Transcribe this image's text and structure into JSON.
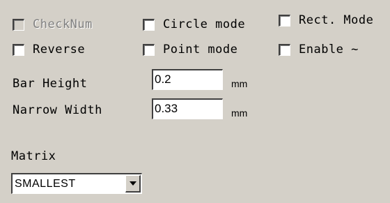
{
  "options": {
    "checknum": "CheckNum",
    "circle_mode": "Circle mode",
    "rect_mode": "Rect. Mode",
    "reverse": "Reverse",
    "point_mode": "Point mode",
    "enable": "Enable ~"
  },
  "bar_height": {
    "label": "Bar Height",
    "value": "0.2",
    "unit": "mm"
  },
  "narrow_width": {
    "label": "Narrow Width",
    "value": "0.33",
    "unit": "mm"
  },
  "matrix": {
    "label": "Matrix",
    "selected": "SMALLEST"
  }
}
